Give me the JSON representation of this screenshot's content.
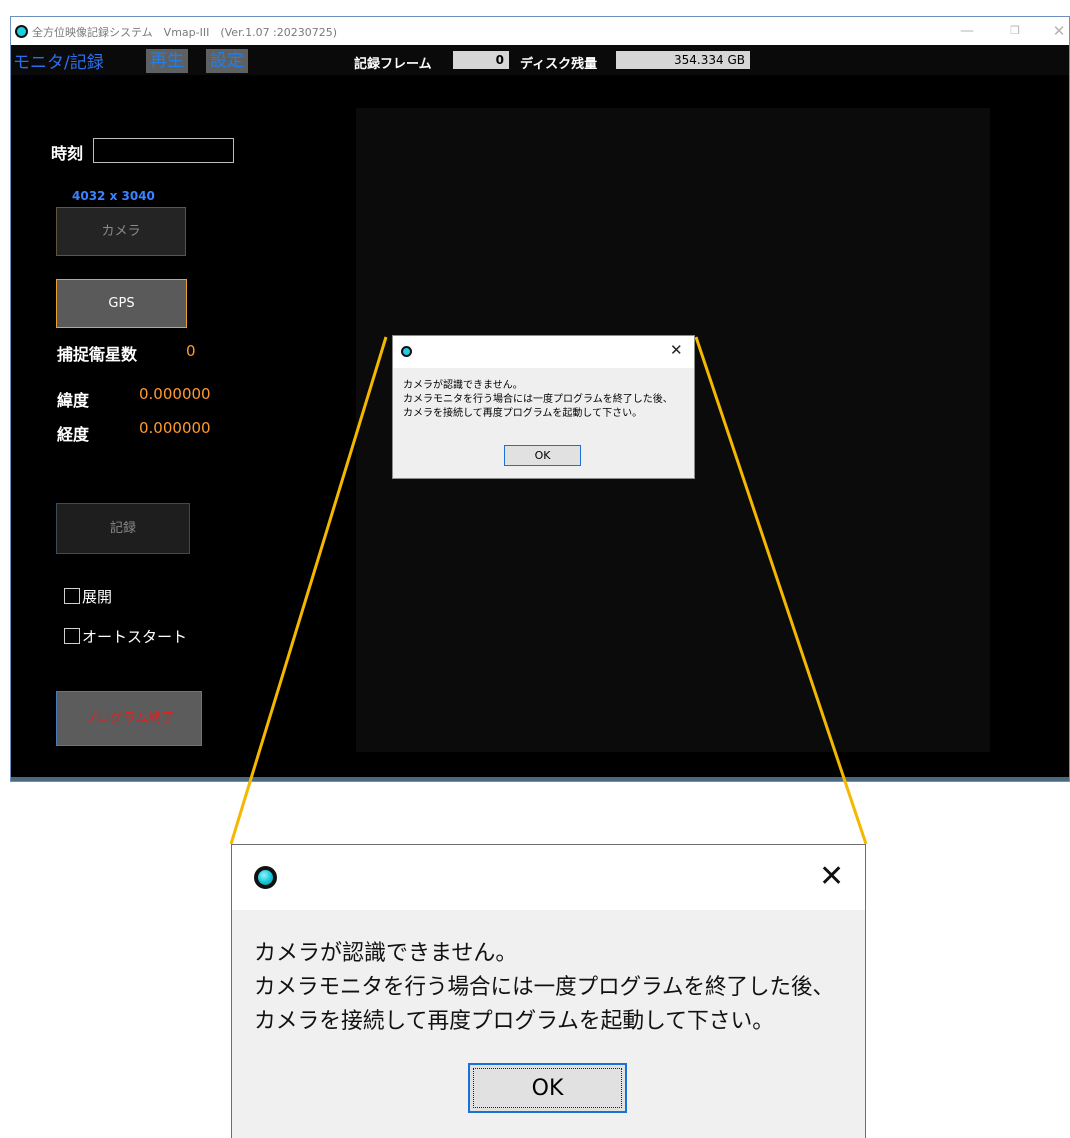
{
  "window": {
    "title": "全方位映像記録システム　Vmap-III　(Ver.1.07 :20230725)",
    "minimize_glyph": "—",
    "maximize_glyph": "❐",
    "close_glyph": "✕"
  },
  "menu": {
    "monitor_tab": "モニタ/記録",
    "playback_tab": "再生",
    "settings_tab": "設定"
  },
  "status": {
    "record_frame_label": "記録フレーム",
    "record_frame_value": "0",
    "disk_label": "ディスク残量",
    "disk_value": "354.334 GB"
  },
  "panel": {
    "time_label": "時刻",
    "time_value": "",
    "resolution": "4032 x 3040",
    "camera_button": "カメラ",
    "gps_button": "GPS",
    "satellites_label": "捕捉衛星数",
    "satellites_value": "0",
    "latitude_label": "緯度",
    "latitude_value": "0.000000",
    "longitude_label": "経度",
    "longitude_value": "0.000000",
    "record_button": "記録",
    "expand_checkbox": "展開",
    "expand_checked": false,
    "autostart_checkbox": "オートスタート",
    "autostart_checked": false,
    "exit_button": "プログラム終了"
  },
  "dialog": {
    "close_glyph": "✕",
    "message_lines": [
      "カメラが認識できません。",
      "カメラモニタを行う場合には一度プログラムを終了した後、",
      "カメラを接続して再度プログラムを起動して下さい。"
    ],
    "ok_button": "OK"
  },
  "colors": {
    "callout_line": "#f5b800",
    "accent_blue": "#1a72d6",
    "value_orange": "#ff9a30",
    "exit_red": "#e02020"
  }
}
